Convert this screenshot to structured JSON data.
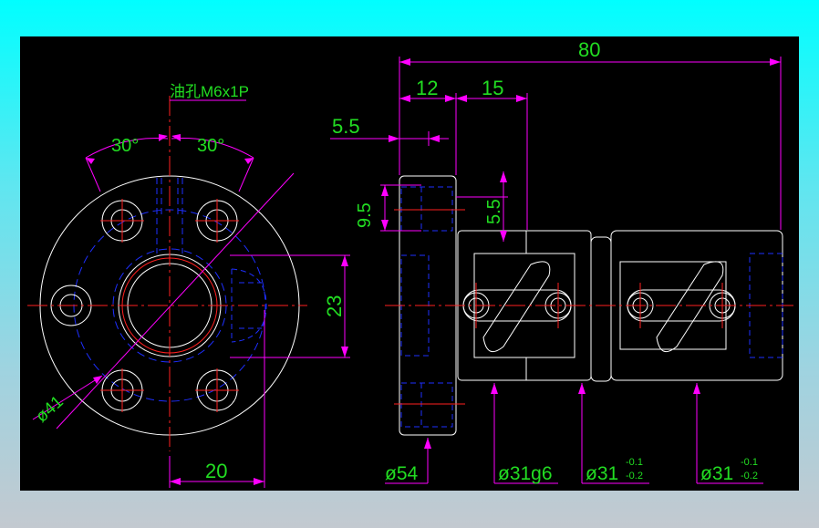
{
  "colors": {
    "background": "#000000",
    "frame_gradient_top": "#00ffff",
    "frame_gradient_bottom": "#c3c9d0",
    "outline": "#ffffff",
    "hidden": "#1e2fff",
    "center": "#ff2020",
    "dimension": "#ff00ff",
    "text": "#22dd22"
  },
  "labels": {
    "oil_hole": "油孔M6x1P",
    "angle_left": "30°",
    "angle_right": "30°",
    "dim_23": "23",
    "dim_41": "ø41",
    "dim_20": "20",
    "dim_80": "80",
    "dim_12": "12",
    "dim_15": "15",
    "dim_5_5_top": "5.5",
    "dim_9_5": "9.5",
    "dim_5_5_side": "5.5",
    "dia_54": "ø54",
    "dia_31g6": "ø31g6",
    "dia_31_a": "ø31",
    "dia_31_a_upper": "-0.1",
    "dia_31_a_lower": "-0.2",
    "dia_31_b": "ø31",
    "dia_31_b_upper": "-0.1",
    "dia_31_b_lower": "-0.2"
  }
}
